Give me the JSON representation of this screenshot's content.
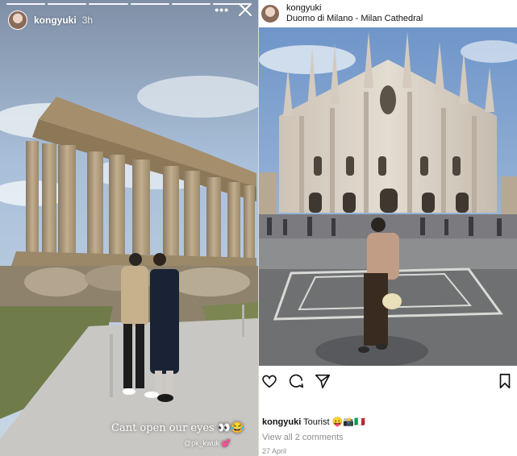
{
  "story": {
    "username": "kongyuki",
    "time": "3h",
    "more_icon": "more-horizontal-icon",
    "close_icon": "close-icon",
    "caption": "Cant open our eyes 👀😂",
    "tag": "@pk_kwuk 💕",
    "progress_segments": 6,
    "progress_done": 6
  },
  "post": {
    "username": "kongyuki",
    "location": "Duomo di Milano - Milan Cathedral",
    "caption_user": "kongyuki",
    "caption_text": " Tourist 😛📸🇮🇹",
    "view_comments": "View all 2 comments",
    "date": "27 April",
    "icons": [
      "heart-icon",
      "comment-icon",
      "share-icon",
      "bookmark-icon"
    ]
  },
  "colors": {
    "sky": "#8fb0d6",
    "marble": "#d8d0c6",
    "text_muted": "#8e8e8e"
  }
}
